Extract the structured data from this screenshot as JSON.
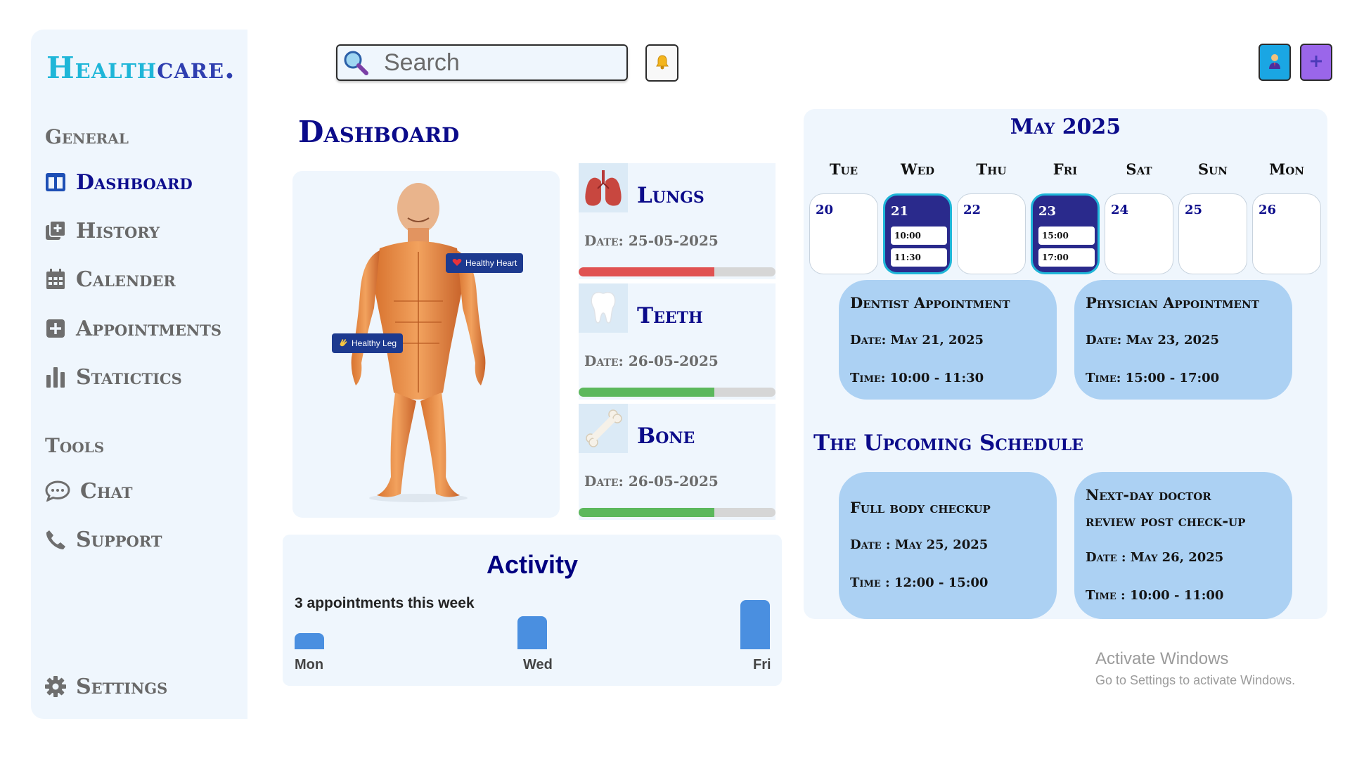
{
  "brand": {
    "part1": "Health",
    "part2": "care."
  },
  "sidebar": {
    "general_title": "General",
    "items": [
      {
        "label": "Dashboard",
        "icon": "dashboard-icon",
        "active": true
      },
      {
        "label": "History",
        "icon": "history-icon"
      },
      {
        "label": "Calender",
        "icon": "calendar-icon"
      },
      {
        "label": "Appointments",
        "icon": "plus-square-icon"
      },
      {
        "label": "Statictics",
        "icon": "bar-chart-icon"
      }
    ],
    "tools_title": "Tools",
    "tools": [
      {
        "label": "Chat",
        "icon": "chat-icon"
      },
      {
        "label": "Support",
        "icon": "phone-icon"
      }
    ],
    "settings_label": "Settings"
  },
  "header": {
    "search_placeholder": "Search",
    "buttons": [
      "bell-icon",
      "profile-icon",
      "plus-icon"
    ]
  },
  "dashboard": {
    "title": "Dashboard",
    "body_tags": {
      "heart": "Healthy Heart",
      "leg": "Healthy Leg"
    },
    "organs": [
      {
        "name": "Lungs",
        "date": "Date: 25-05-2025",
        "progress": 0.69,
        "color": "#e05252"
      },
      {
        "name": "Teeth",
        "date": "Date: 26-05-2025",
        "progress": 0.69,
        "color": "#5cb85c"
      },
      {
        "name": "Bone",
        "date": "Date: 26-05-2025",
        "progress": 0.69,
        "color": "#5cb85c"
      }
    ]
  },
  "activity": {
    "title": "Activity",
    "subtitle": "3 appointments this week",
    "bars": [
      {
        "day": "Mon",
        "value": 1
      },
      {
        "day": "Wed",
        "value": 2
      },
      {
        "day": "Fri",
        "value": 3
      }
    ]
  },
  "calendar": {
    "month": "May 2025",
    "weekdays": [
      "Tue",
      "Wed",
      "Thu",
      "Fri",
      "Sat",
      "Sun",
      "Mon"
    ],
    "days": [
      {
        "num": "20",
        "selected": false,
        "slots": []
      },
      {
        "num": "21",
        "selected": true,
        "slots": [
          "10:00",
          "11:30"
        ]
      },
      {
        "num": "22",
        "selected": false,
        "slots": []
      },
      {
        "num": "23",
        "selected": true,
        "slots": [
          "15:00",
          "17:00"
        ]
      },
      {
        "num": "24",
        "selected": false,
        "slots": []
      },
      {
        "num": "25",
        "selected": false,
        "slots": []
      },
      {
        "num": "26",
        "selected": false,
        "slots": []
      }
    ],
    "appointments": [
      {
        "title": "Dentist Appointment",
        "date": "Date: May 21, 2025",
        "time": "Time: 10:00 - 11:30"
      },
      {
        "title": "Physician Appointment",
        "date": "Date: May 23, 2025",
        "time": "Time: 15:00 - 17:00"
      }
    ],
    "upcoming_title": "The Upcoming Schedule",
    "upcoming": [
      {
        "title": "Full body checkup",
        "date": "Date : May 25, 2025",
        "time": "Time : 12:00 - 15:00"
      },
      {
        "title_line1": "Next-day doctor",
        "title_line2": "review post check-up",
        "date": "Date : May 26, 2025",
        "time": "Time : 10:00 - 11:00"
      }
    ]
  },
  "watermark": {
    "line1": "Activate Windows",
    "line2": "Go to Settings to activate Windows."
  },
  "colors": {
    "navy": "#0b0b8a",
    "panel": "#eff6fd",
    "card": "#acd1f3",
    "teal": "#1fb6d8"
  }
}
